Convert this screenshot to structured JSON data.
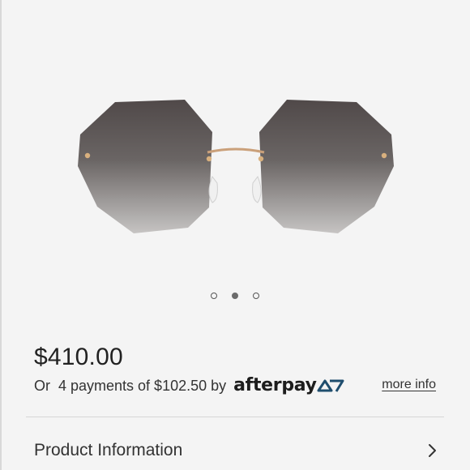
{
  "product": {
    "price": "$410.00",
    "payments_text": "Or  4 payments of $102.50 by",
    "afterpay_brand": "afterpay",
    "more_info_label": "more info",
    "image_icon": "sunglasses-image"
  },
  "carousel": {
    "dot_count": 3,
    "active_index": 1
  },
  "sections": {
    "product_information_label": "Product Information",
    "chevron_icon": "chevron-right-icon"
  },
  "colors": {
    "background": "#f4f4f4",
    "text": "#222222",
    "afterpay_accent": "#1d4f6b"
  }
}
